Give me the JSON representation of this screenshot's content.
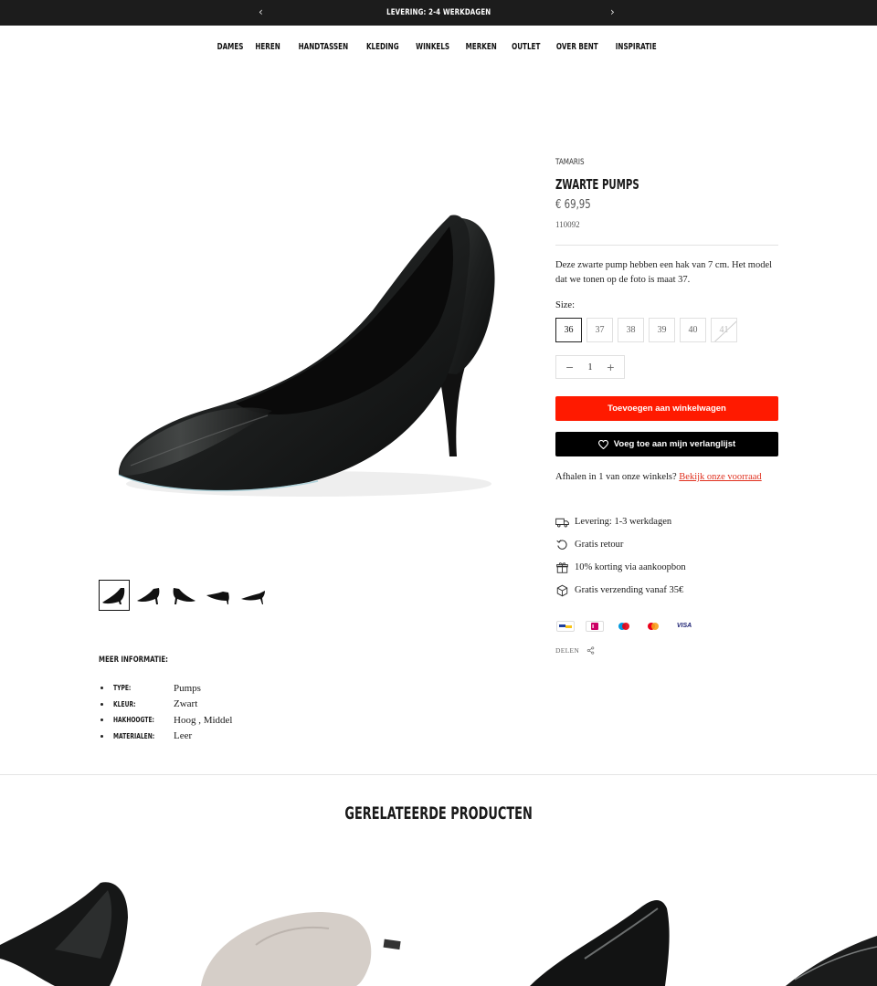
{
  "announcement": {
    "text": "LEVERING: 2-4 WERKDAGEN",
    "prev": "‹",
    "next": "›"
  },
  "nav": [
    "DAMES",
    "HEREN",
    "HANDTASSEN",
    "KLEDING",
    "WINKELS",
    "MERKEN",
    "OUTLET",
    "OVER BENT",
    "INSPIRATIE"
  ],
  "product": {
    "brand": "TAMARIS",
    "title": "ZWARTE PUMPS",
    "price": "€ 69,95",
    "sku": "110092",
    "description": "Deze zwarte pump hebben een hak van 7 cm. Het model dat we tonen op de foto is maat 37.",
    "size_label": "Size:",
    "sizes": [
      "36",
      "37",
      "38",
      "39",
      "40",
      "41"
    ],
    "selected_size": "36",
    "unavailable_size": "41",
    "quantity": "1",
    "qty_minus": "−",
    "qty_plus": "+",
    "add_to_cart": "Toevoegen aan winkelwagen",
    "wishlist": "Voeg toe aan mijn verlanglijst",
    "pickup_text": "Afhalen in 1 van onze winkels?",
    "pickup_link": "Bekijk onze voorraad",
    "usps": [
      {
        "icon": "truck-icon",
        "text": "Levering: 1-3 werkdagen"
      },
      {
        "icon": "return-icon",
        "text": "Gratis retour"
      },
      {
        "icon": "gift-icon",
        "text": "10% korting via aankoopbon"
      },
      {
        "icon": "box-icon",
        "text": "Gratis verzending vanaf 35€"
      }
    ],
    "payments": [
      "bancontact-icon",
      "ideal-icon",
      "maestro-icon",
      "mastercard-icon",
      "visa-icon"
    ],
    "visa_text": "VISA",
    "share": "DELEN"
  },
  "more_info": {
    "title": "MEER INFORMATIE:",
    "rows": [
      {
        "key": "TYPE:",
        "value": "Pumps"
      },
      {
        "key": "KLEUR:",
        "value": "Zwart"
      },
      {
        "key": "HAKHOOGTE:",
        "value": "Hoog , Middel"
      },
      {
        "key": "MATERIALEN:",
        "value": "Leer"
      }
    ]
  },
  "related": {
    "title": "GERELATEERDE PRODUCTEN"
  },
  "colors": {
    "accent": "#ff1a00",
    "link": "#e0311f",
    "dark": "#1c1c1c"
  }
}
